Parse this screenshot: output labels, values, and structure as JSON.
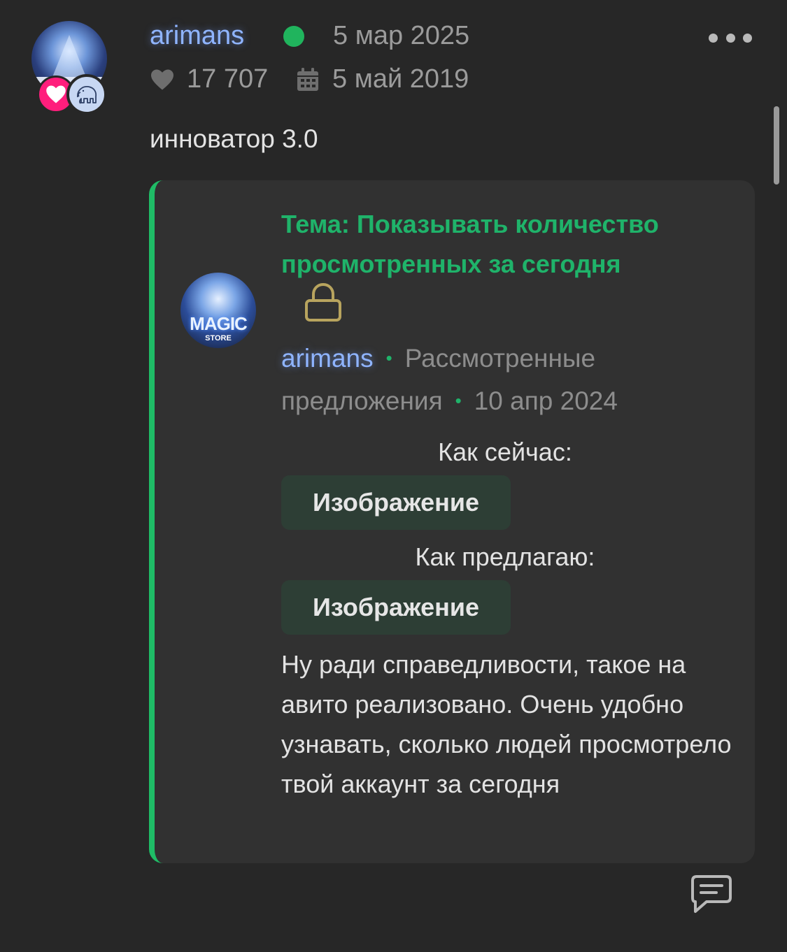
{
  "post": {
    "username": "arimans",
    "date": "5 мар 2025",
    "likes": "17 707",
    "registered": "5 май 2019",
    "user_title": "инноватор 3.0"
  },
  "quote": {
    "thread_title": "Тема: Показывать количество просмотренных за сегодня",
    "author": "arimans",
    "forum": "Рассмотренные предложения",
    "date": "10 апр 2024",
    "label_now": "Как сейчас:",
    "image_button_1": "Изображение",
    "label_propose": "Как предлагаю:",
    "image_button_2": "Изображение",
    "body": "Ну ради справедливости, такое на авито реализовано. Очень удобно узнавать, сколько людей просмотрело твой аккаунт за сегодня"
  },
  "avatar_text": {
    "magic": "MAGIC",
    "store": "STORE"
  },
  "icons": {
    "heart": "heart-icon",
    "calendar": "calendar-icon",
    "more": "more-icon",
    "lock": "lock-icon",
    "reply": "reply-icon",
    "online": "online-status-dot",
    "heart_badge": "heart-badge-icon",
    "mammoth_badge": "mammoth-badge-icon"
  },
  "colors": {
    "background": "#272727",
    "card": "#313131",
    "accent_green": "#1fb36a",
    "username_blue": "#8fb4ff",
    "online_green": "#20b45d",
    "badge_pink": "#ff1e7c"
  }
}
